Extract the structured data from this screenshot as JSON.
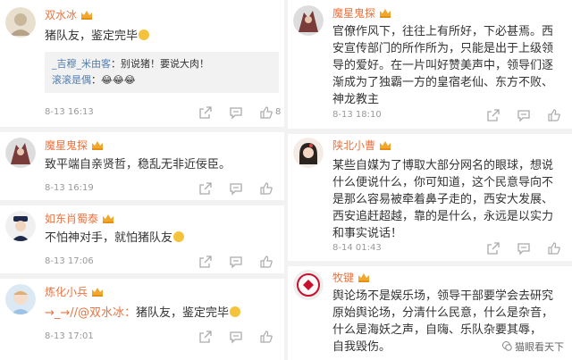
{
  "left": [
    {
      "username": "双水冰",
      "text": "猪队友，鉴定完毕",
      "replies": [
        {
          "name": "_吉穆_米由客",
          "text": "：别说猪！要说大肉！"
        },
        {
          "name": "滚滚是偶",
          "text": "：😂😂😂"
        }
      ],
      "time": "8-13 16:13",
      "likes": "8"
    },
    {
      "username": "魔星鬼探",
      "text": "致平端自亲贤哲，稳乱无非近佞臣。",
      "time": "8-13 16:19",
      "likes": ""
    },
    {
      "username": "如东肖蜀泰",
      "text": "不怕神对手，就怕猪队友",
      "time": "8-13 17:06",
      "likes": ""
    },
    {
      "username": "炼化小兵",
      "mention": "→_→//@双水冰：",
      "text": "猪队友，鉴定完毕",
      "time": "8-13 17:01",
      "likes": ""
    }
  ],
  "right": [
    {
      "username": "魔星鬼探",
      "lines": [
        "官僚作风下，往往上有所好，下必甚焉。西",
        "安宣传部门的所作所为，只能是出于上级领",
        "导的爱好。在一片叫好赞美声中，领导们逐",
        "渐成为了独霸一方的皇宿老仙、东方不败、",
        "神龙教主"
      ],
      "time": "8-13 18:10",
      "likes": ""
    },
    {
      "username": "陕北小曹",
      "lines": [
        "某些自媒为了博取大部分网名的眼球，想说",
        "什么便说什么，你可知道，这个民意导向不",
        "是那么容易被牵着鼻子走的，西安大发展、",
        "西安追赶超越，靠的是什么，永远是以实力",
        "和事实说话！"
      ],
      "time": "8-14 01:43",
      "likes": ""
    },
    {
      "username": "牧键",
      "lines": [
        "舆论场不是娱乐场，领导干部要学会去研究",
        "原始舆论场，分清什么民意，什么是杂音，",
        "什么是海妖之声，自嗨、乐队杂要其辱，",
        "自我毁伤。"
      ],
      "time": "",
      "likes": ""
    }
  ],
  "watermark": "猫眼看天下",
  "colors": {
    "username": "#eb7340",
    "reply_name": "#507daf",
    "reply_bg": "#f2f2f2",
    "meta": "#999999",
    "separator": "#f2f2f2"
  },
  "icons": [
    "share-icon",
    "comment-icon",
    "like-icon",
    "vip-crown-icon",
    "avatar"
  ]
}
